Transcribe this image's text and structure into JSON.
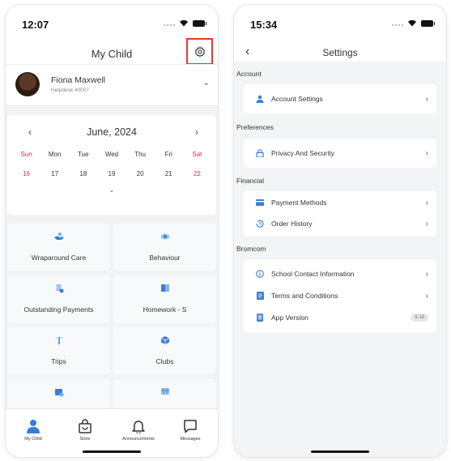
{
  "left": {
    "status_time": "12:07",
    "title": "My Child",
    "profile": {
      "name": "Fiona Maxwell",
      "subtitle": "Helpdesk 40007"
    },
    "calendar": {
      "month": "June, 2024",
      "days": [
        "Sun",
        "Mon",
        "Tue",
        "Wed",
        "Thu",
        "Fri",
        "Sat"
      ],
      "dates": [
        "16",
        "17",
        "18",
        "19",
        "20",
        "21",
        "22"
      ]
    },
    "tiles": [
      {
        "label": "Wraparound Care",
        "icon": "hand-care-icon"
      },
      {
        "label": "Behaviour",
        "icon": "behaviour-icon"
      },
      {
        "label": "Outstanding Payments",
        "icon": "payments-icon"
      },
      {
        "label": "Homework - S",
        "icon": "book-icon"
      },
      {
        "label": "Trips",
        "icon": "palm-tree-icon"
      },
      {
        "label": "Clubs",
        "icon": "clubs-icon"
      },
      {
        "label": "",
        "icon": "calendar-icon"
      },
      {
        "label": "",
        "icon": "timetable-icon"
      }
    ],
    "tabs": [
      {
        "label": "My Child",
        "icon": "person-icon"
      },
      {
        "label": "Store",
        "icon": "bag-icon"
      },
      {
        "label": "Announcements",
        "icon": "bell-icon"
      },
      {
        "label": "Messages",
        "icon": "chat-icon"
      }
    ]
  },
  "right": {
    "status_time": "15:34",
    "title": "Settings",
    "sections": {
      "account": "Account",
      "preferences": "Preferences",
      "financial": "Financial",
      "bromcom": "Bromcom"
    },
    "rows": {
      "account_settings": "Account Settings",
      "privacy": "Privacy And Security",
      "payment_methods": "Payment Methods",
      "order_history": "Order History",
      "school_contact": "School Contact Information",
      "terms": "Terms and Conditions",
      "app_version": "App Version",
      "app_version_value": "6.18"
    }
  },
  "colors": {
    "accent_blue": "#3b7dd8",
    "weekend_red": "#e0303a",
    "highlight_red": "#e33b2e",
    "background_gray": "#f1f3f5"
  }
}
